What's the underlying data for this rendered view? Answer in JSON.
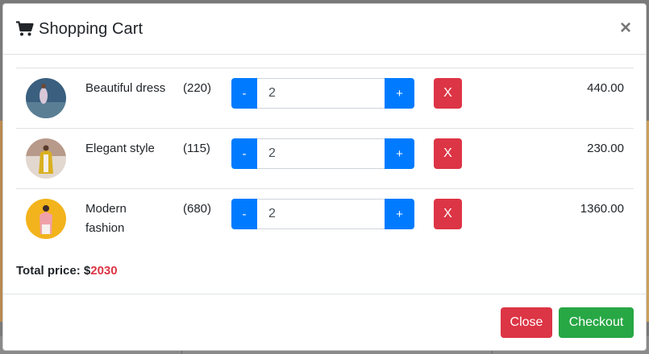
{
  "modal": {
    "title": "Shopping Cart",
    "close_symbol": "×",
    "cart_icon": "shopping-cart-icon"
  },
  "items": [
    {
      "name": "Beautiful dress",
      "qty_label": "(220)",
      "quantity": "2",
      "price": "440.00",
      "minus_label": "-",
      "plus_label": "+",
      "remove_label": "X",
      "avatar_color": "#3a5f7f"
    },
    {
      "name": "Elegant style",
      "qty_label": "(115)",
      "quantity": "2",
      "price": "230.00",
      "minus_label": "-",
      "plus_label": "+",
      "remove_label": "X",
      "avatar_color": "#c9b48a"
    },
    {
      "name": "Modern fashion",
      "qty_label": "(680)",
      "quantity": "2",
      "price": "1360.00",
      "minus_label": "-",
      "plus_label": "+",
      "remove_label": "X",
      "avatar_color": "#f2b31c"
    }
  ],
  "total": {
    "label": "Total price: $",
    "amount": "2030"
  },
  "footer": {
    "close_label": "Close",
    "checkout_label": "Checkout"
  },
  "colors": {
    "primary": "#007bff",
    "danger": "#dc3545",
    "success": "#28a745"
  }
}
